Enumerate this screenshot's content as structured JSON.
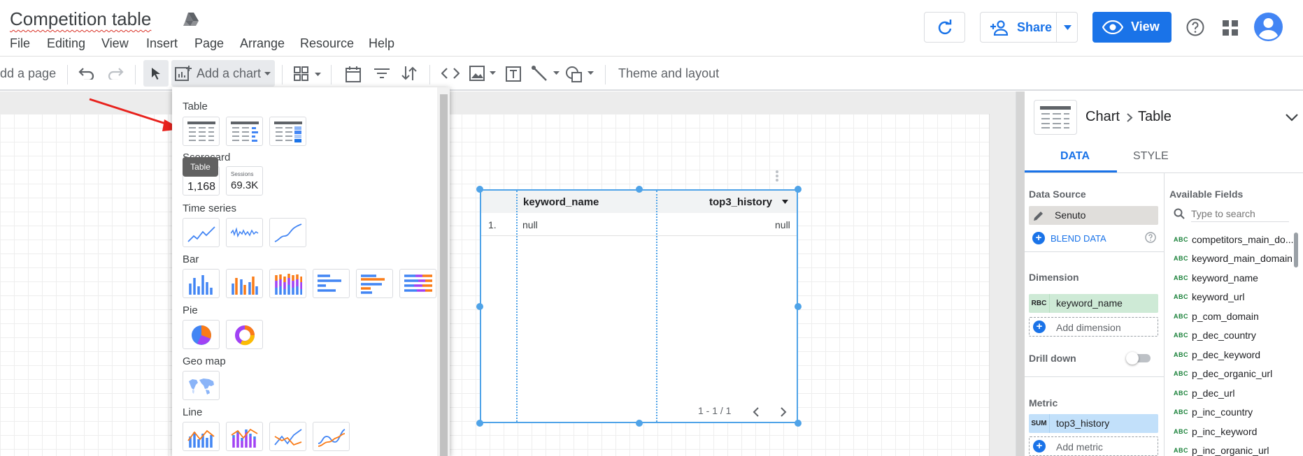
{
  "title": "Competition table",
  "menu": [
    "File",
    "Editing",
    "View",
    "Insert",
    "Page",
    "Arrange",
    "Resource",
    "Help"
  ],
  "header": {
    "share_label": "Share",
    "view_label": "View"
  },
  "toolbar": {
    "add_page": "dd a page",
    "add_chart": "Add a chart",
    "theme_layout": "Theme and layout"
  },
  "chart_menu": {
    "categories": {
      "table": "Table",
      "scorecard": "Scorecard",
      "time_series": "Time series",
      "bar": "Bar",
      "pie": "Pie",
      "geo_map": "Geo map",
      "line": "Line"
    },
    "tooltip": "Table",
    "scorecard_values": {
      "first": "1,168",
      "second_label": "Sessions",
      "second": "69.3K"
    }
  },
  "table_chart": {
    "columns": [
      "keyword_name",
      "top3_history"
    ],
    "rows": [
      {
        "index": "1.",
        "keyword_name": "null",
        "top3_history": "null"
      }
    ],
    "pagination": "1 - 1 / 1"
  },
  "panel": {
    "breadcrumb": {
      "chart": "Chart",
      "type": "Table"
    },
    "tabs": [
      "DATA",
      "STYLE"
    ],
    "data_source_label": "Data Source",
    "data_source": "Senuto",
    "blend_label": "BLEND DATA",
    "dimension_label": "Dimension",
    "dimension": {
      "tag": "RBC",
      "name": "keyword_name"
    },
    "add_dimension": "Add dimension",
    "drill_down": "Drill down",
    "metric_label": "Metric",
    "metric": {
      "tag": "SUM",
      "name": "top3_history"
    },
    "add_metric": "Add metric",
    "available_fields_label": "Available Fields",
    "search_placeholder": "Type to search",
    "fields": [
      "competitors_main_do...",
      "keyword_main_domain",
      "keyword_name",
      "keyword_url",
      "p_com_domain",
      "p_dec_country",
      "p_dec_keyword",
      "p_dec_organic_url",
      "p_dec_url",
      "p_inc_country",
      "p_inc_keyword",
      "p_inc_organic_url"
    ]
  },
  "colors": {
    "accent": "#1a73e8",
    "selection": "#4fa3e8",
    "dimension_bg": "#ceead6",
    "metric_bg": "#c2e0fa",
    "annotation_arrow": "#e8221d"
  }
}
